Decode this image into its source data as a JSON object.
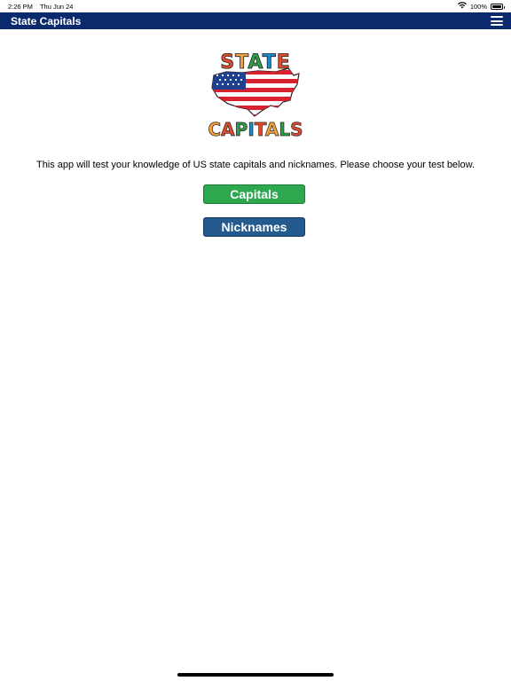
{
  "status_bar": {
    "time": "2:26 PM",
    "date": "Thu Jun 24",
    "battery_text": "100%",
    "battery_level": 1.0
  },
  "navbar": {
    "title": "State Capitals",
    "menu_icon": "hamburger-menu-icon",
    "background": "#0b2a6d"
  },
  "logo": {
    "word_top": "STATE",
    "word_bottom": "CAPITALS",
    "colors": [
      "#e04b2e",
      "#f2a23a",
      "#2f9e4a",
      "#1f8ac9",
      "#e04b2e",
      "#2f9e4a"
    ]
  },
  "main": {
    "intro": "This app will test your knowledge of US state capitals and nicknames. Please choose your test below.",
    "buttons": {
      "capitals_label": "Capitals",
      "nicknames_label": "Nicknames"
    }
  },
  "colors": {
    "capitals_button": "#2ea84f",
    "nicknames_button": "#245a8e"
  }
}
